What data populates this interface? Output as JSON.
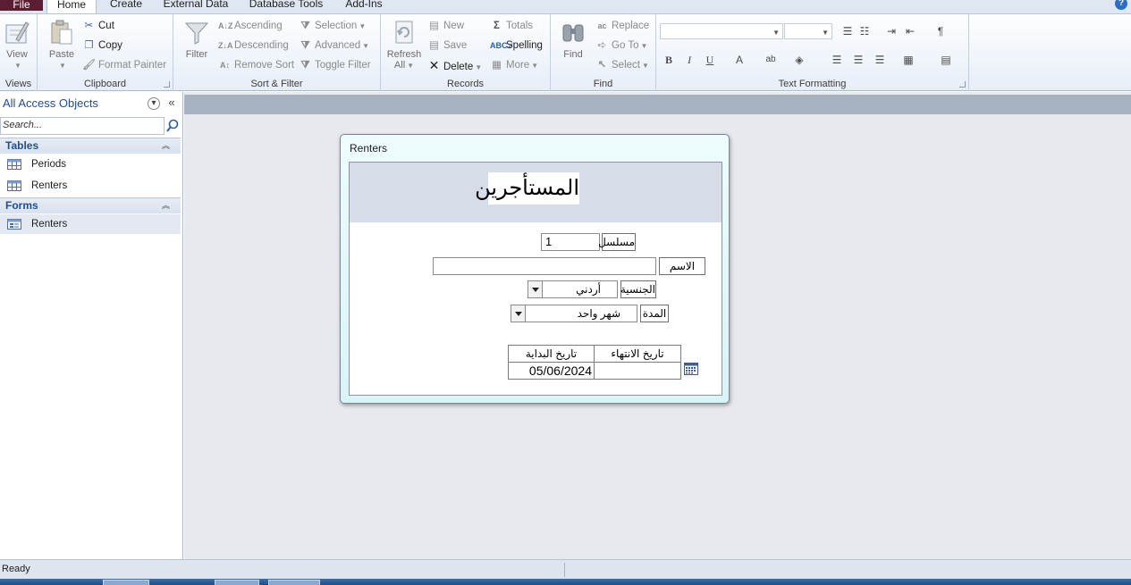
{
  "tabs": [
    {
      "label": "File"
    },
    {
      "label": "Home"
    },
    {
      "label": "Create"
    },
    {
      "label": "External Data"
    },
    {
      "label": "Database Tools"
    },
    {
      "label": "Add-Ins"
    }
  ],
  "ribbon": {
    "views": {
      "view": "View",
      "group": "Views"
    },
    "clipboard": {
      "paste": "Paste",
      "cut": "Cut",
      "copy": "Copy",
      "format_painter": "Format Painter",
      "group": "Clipboard"
    },
    "sort_filter": {
      "filter": "Filter",
      "ascending": "Ascending",
      "descending": "Descending",
      "remove_sort": "Remove Sort",
      "selection": "Selection",
      "advanced": "Advanced",
      "toggle_filter": "Toggle Filter",
      "group": "Sort & Filter"
    },
    "records": {
      "refresh": "Refresh",
      "refresh_all": "All",
      "new": "New",
      "save": "Save",
      "delete": "Delete",
      "totals": "Totals",
      "spelling": "Spelling",
      "more": "More",
      "group": "Records"
    },
    "find": {
      "find": "Find",
      "replace": "Replace",
      "goto": "Go To",
      "select": "Select",
      "group": "Find"
    },
    "text_formatting": {
      "group": "Text Formatting"
    }
  },
  "nav": {
    "title": "All Access Objects",
    "search_placeholder": "Search...",
    "sections": [
      {
        "label": "Tables",
        "items": [
          "Periods",
          "Renters"
        ]
      },
      {
        "label": "Forms",
        "items": [
          "Renters"
        ]
      }
    ]
  },
  "form": {
    "window_title": "Renters",
    "header_title": "المستأجرين",
    "serial_label": "مسلسل",
    "serial_value": "1",
    "name_label": "الاسم",
    "name_value": "",
    "nationality_label": "الجنسية",
    "nationality_value": "أردني",
    "period_label": "المدة",
    "period_value": "شهر واحد",
    "start_date_header": "تاريخ البداية",
    "end_date_header": "تاريخ الانتهاء",
    "start_date_value": "05/06/2024",
    "end_date_value": ""
  },
  "status": {
    "text": "Ready"
  },
  "colors": {
    "file_tab": "#5a1d33",
    "nav_title": "#1f4e91",
    "form_header": "#d6dde8",
    "form_frame": "#d9f4f7"
  }
}
